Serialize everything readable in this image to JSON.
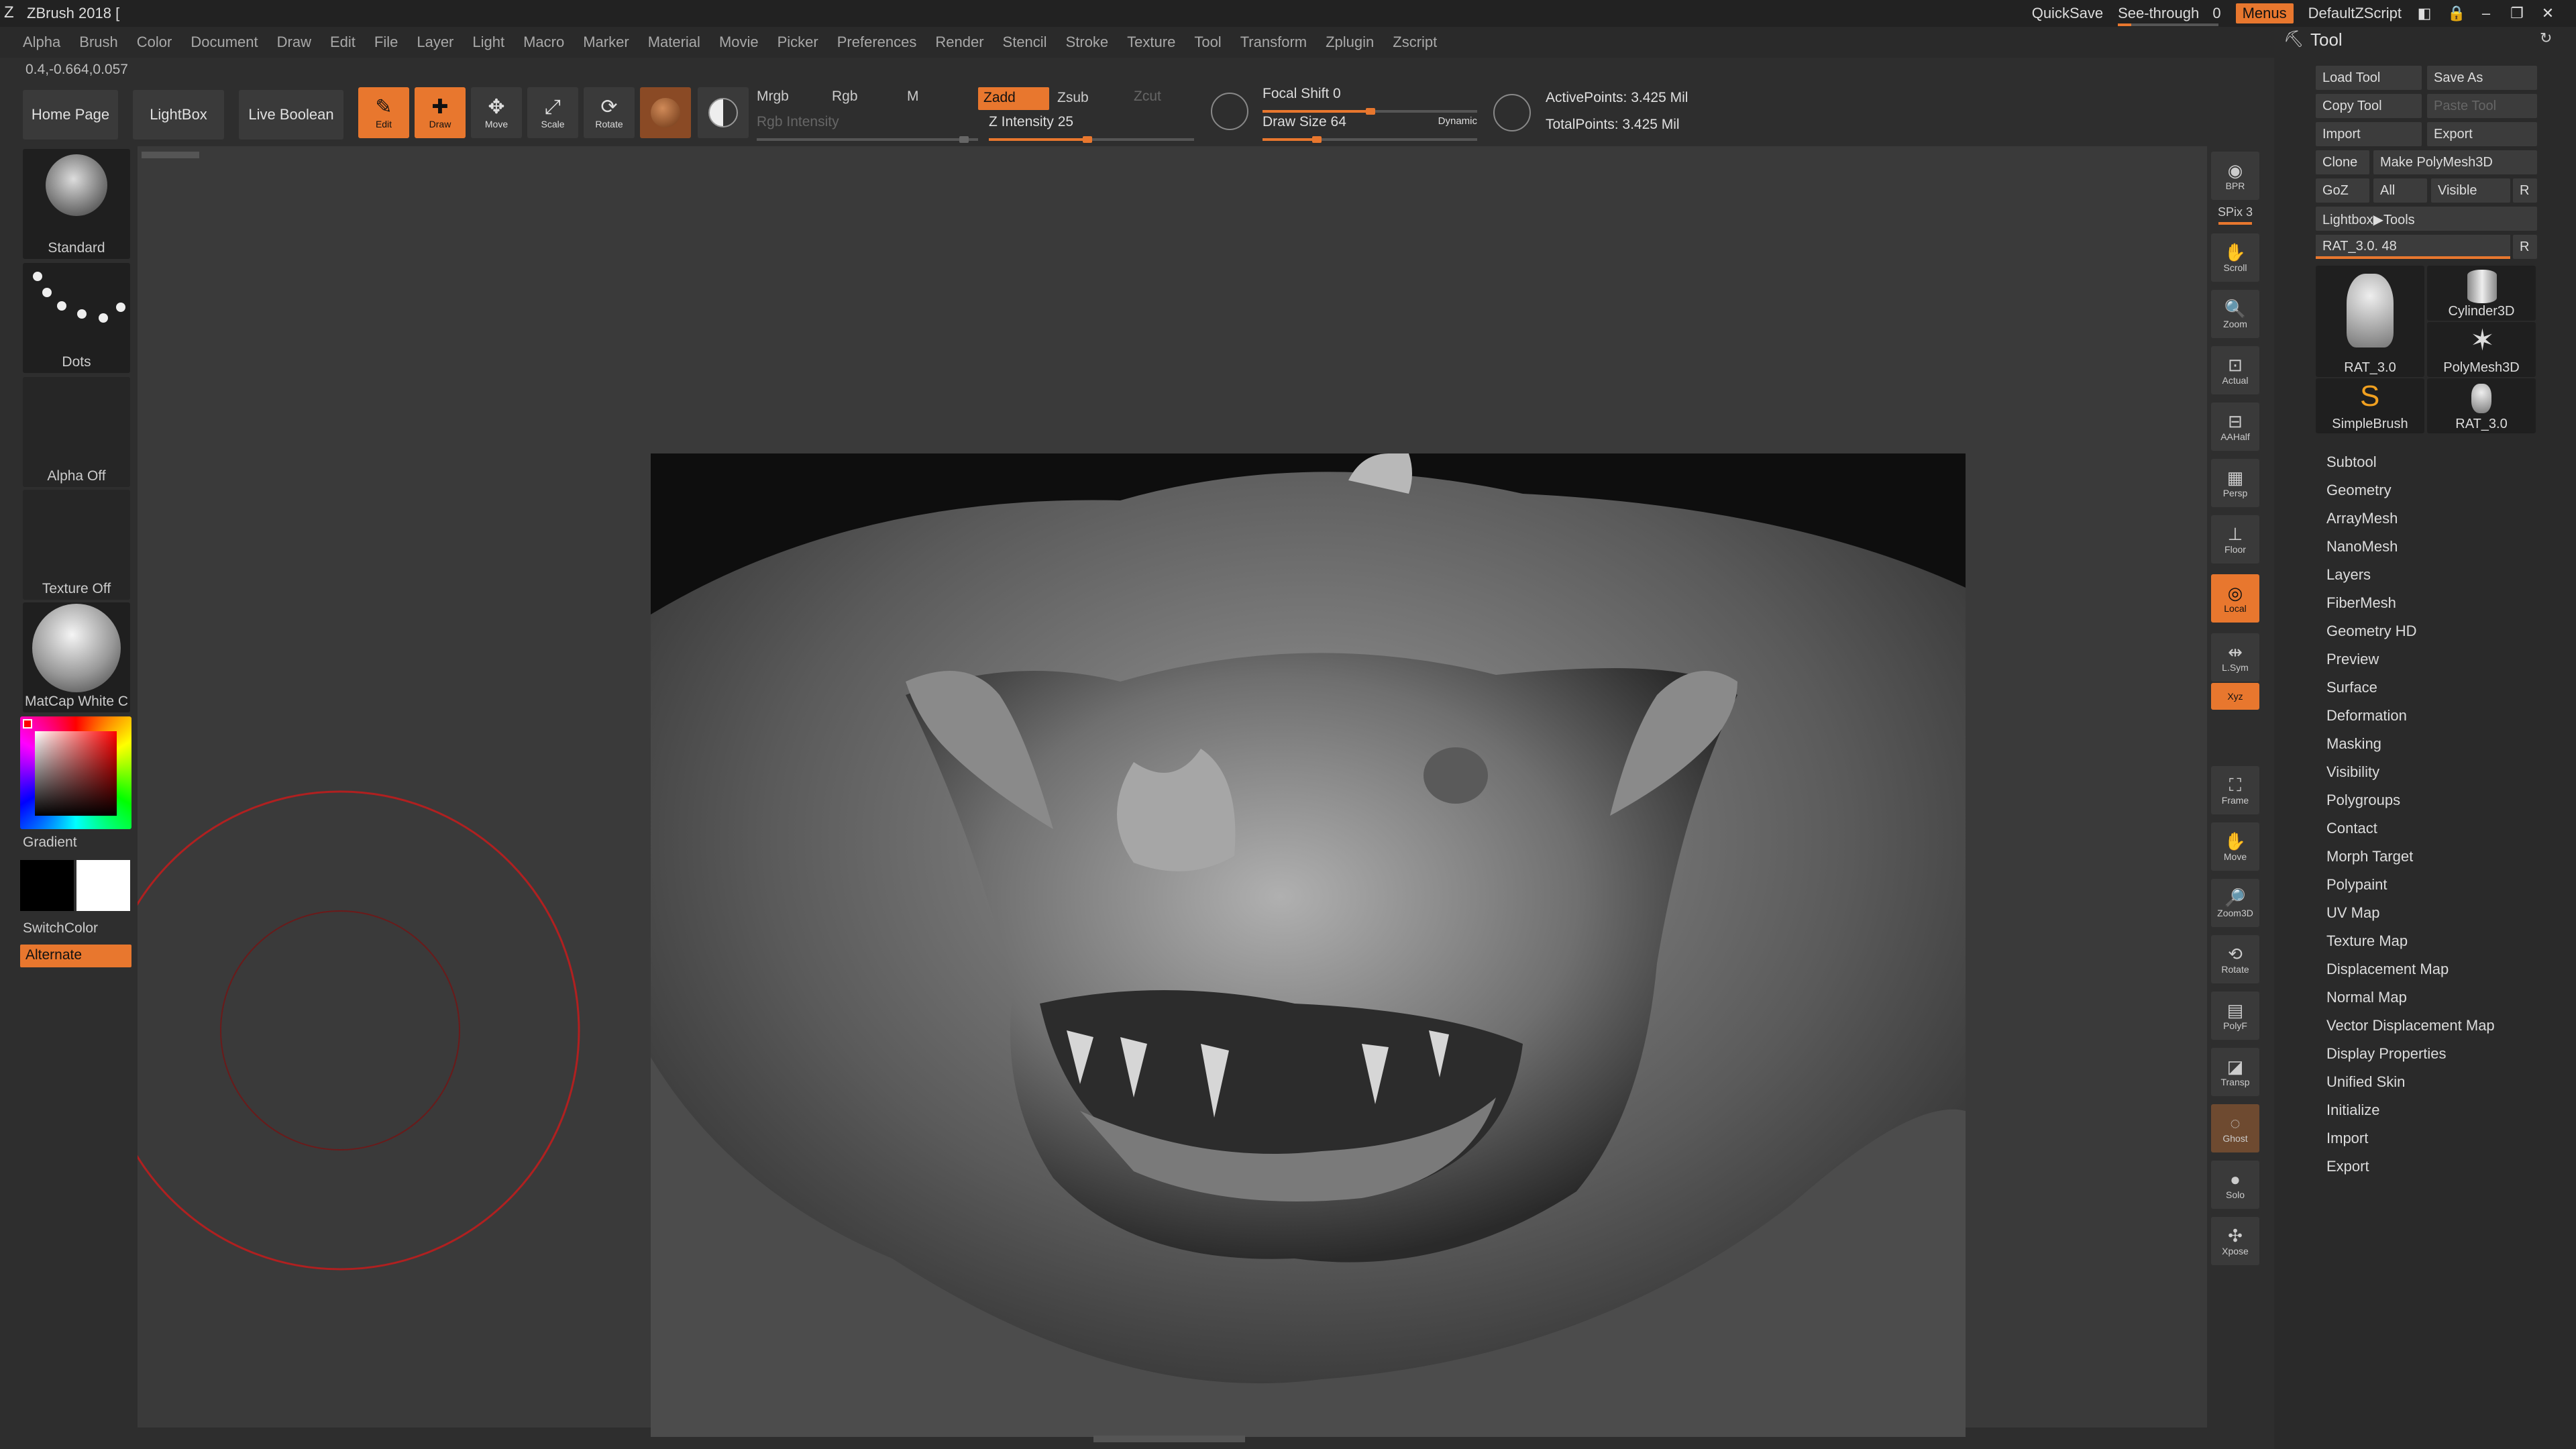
{
  "app": {
    "title": "ZBrush 2018 ["
  },
  "menu": [
    "Alpha",
    "Brush",
    "Color",
    "Document",
    "Draw",
    "Edit",
    "File",
    "Layer",
    "Light",
    "Macro",
    "Marker",
    "Material",
    "Movie",
    "Picker",
    "Preferences",
    "Render",
    "Stencil",
    "Stroke",
    "Texture",
    "Tool",
    "Transform",
    "Zplugin",
    "Zscript"
  ],
  "topright": {
    "quicksave": "QuickSave",
    "see_through": "See-through",
    "see_through_val": "0",
    "menus": "Menus",
    "script": "DefaultZScript"
  },
  "coords": "0.4,-0.664,0.057",
  "toolbar": {
    "home": "Home Page",
    "lightbox": "LightBox",
    "live_boolean": "Live Boolean",
    "edit": "Edit",
    "draw": "Draw",
    "move": "Move",
    "scale": "Scale",
    "rotate": "Rotate",
    "mrgb": "Mrgb",
    "rgb": "Rgb",
    "m": "M",
    "zadd": "Zadd",
    "zsub": "Zsub",
    "zcut": "Zcut",
    "rgb_intensity": "Rgb Intensity",
    "z_intensity": "Z Intensity 25",
    "focal_shift": "Focal Shift 0",
    "draw_size": "Draw Size 64",
    "dynamic": "Dynamic",
    "active_points": "ActivePoints: 3.425 Mil",
    "total_points": "TotalPoints: 3.425 Mil"
  },
  "left": {
    "standard": "Standard",
    "dots": "Dots",
    "alpha_off": "Alpha Off",
    "texture_off": "Texture Off",
    "matcap": "MatCap White C",
    "gradient": "Gradient",
    "switchcolor": "SwitchColor",
    "alternate": "Alternate"
  },
  "dock": [
    "BPR",
    "SPix 3",
    "Scroll",
    "Zoom",
    "Actual",
    "AAHalf",
    "Persp",
    "Floor",
    "Local",
    "L.Sym",
    "Xyz",
    "Frame",
    "Move",
    "Zoom3D",
    "Rotate",
    "PolyF",
    "Transp",
    "Ghost",
    "Solo",
    "Xpose"
  ],
  "panel": {
    "title": "Tool",
    "load_tool": "Load Tool",
    "save_as": "Save As",
    "copy_tool": "Copy Tool",
    "paste_tool": "Paste Tool",
    "import": "Import",
    "export": "Export",
    "clone": "Clone",
    "make_polymesh": "Make PolyMesh3D",
    "goz": "GoZ",
    "all": "All",
    "visible": "Visible",
    "r": "R",
    "lightbox_tools": "Lightbox▶Tools",
    "rat_slider": "RAT_3.0. 48",
    "thumbs": [
      "RAT_3.0",
      "Cylinder3D",
      "PolyMesh3D",
      "SimpleBrush",
      "RAT_3.0"
    ],
    "items": [
      "Subtool",
      "Geometry",
      "ArrayMesh",
      "NanoMesh",
      "Layers",
      "FiberMesh",
      "Geometry HD",
      "Preview",
      "Surface",
      "Deformation",
      "Masking",
      "Visibility",
      "Polygroups",
      "Contact",
      "Morph Target",
      "Polypaint",
      "UV Map",
      "Texture Map",
      "Displacement Map",
      "Normal Map",
      "Vector Displacement Map",
      "Display Properties",
      "Unified Skin",
      "Initialize",
      "Import",
      "Export"
    ]
  },
  "colors": {
    "accent": "#e8772e"
  }
}
